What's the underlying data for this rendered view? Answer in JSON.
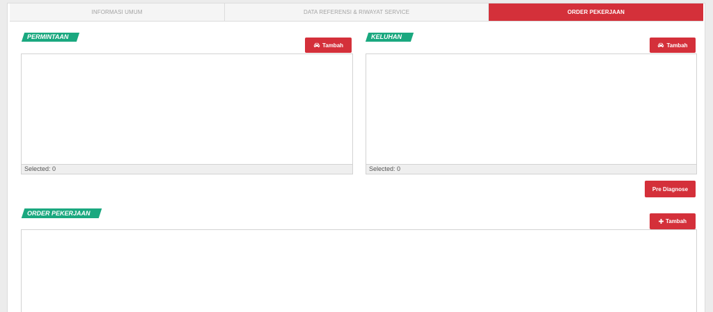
{
  "tabs": [
    {
      "label": "INFORMASI UMUM",
      "active": false
    },
    {
      "label": "DATA REFERENSI & RIWAYAT SERVICE",
      "active": false
    },
    {
      "label": "ORDER PEKERJAAN",
      "active": true
    }
  ],
  "permintaan": {
    "title": "PERMINTAAN",
    "add_button": {
      "label": "Tambah",
      "icon": "car-icon"
    },
    "footer": "Selected: 0"
  },
  "keluhan": {
    "title": "KELUHAN",
    "add_button": {
      "label": "Tambah",
      "icon": "car-icon"
    },
    "footer": "Selected: 0"
  },
  "pre_diagnose": {
    "label": "Pre Diagnose"
  },
  "order_pekerjaan": {
    "title": "ORDER PEKERJAAN",
    "add_button": {
      "label": "Tambah",
      "icon": "plus-icon"
    }
  },
  "colors": {
    "accent_red": "#d4303a",
    "section_green": "#1aa87f",
    "tab_inactive_bg": "#f5f5f5"
  }
}
